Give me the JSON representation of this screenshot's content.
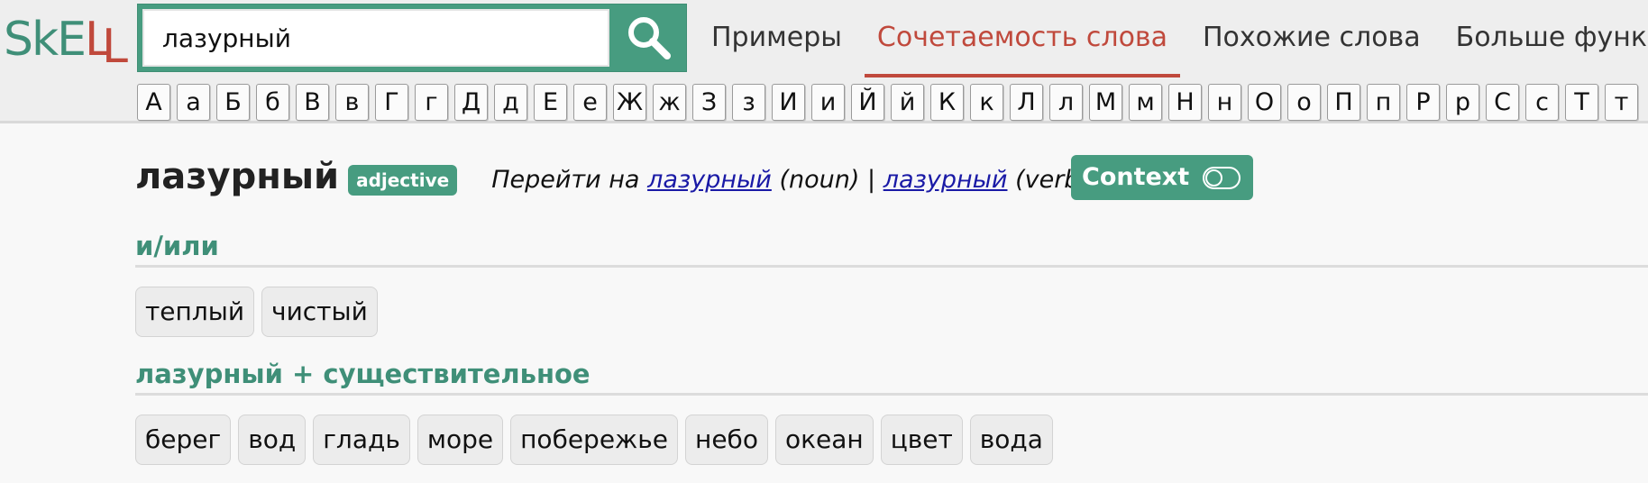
{
  "logo": {
    "s": "S",
    "k": "k",
    "e": "E",
    "l1": "L",
    "l2": "L"
  },
  "search": {
    "value": "лазурный",
    "placeholder": "",
    "button_icon": "search-icon"
  },
  "nav": {
    "items": [
      {
        "label": "Примеры",
        "active": false
      },
      {
        "label": "Сочетаемость слова",
        "active": true
      },
      {
        "label": "Похожие слова",
        "active": false
      },
      {
        "label": "Больше функций",
        "active": false
      }
    ]
  },
  "alphabet": [
    "А",
    "а",
    "Б",
    "б",
    "В",
    "в",
    "Г",
    "г",
    "Д",
    "д",
    "Е",
    "е",
    "Ж",
    "ж",
    "З",
    "з",
    "И",
    "и",
    "Й",
    "й",
    "К",
    "к",
    "Л",
    "л",
    "М",
    "м",
    "Н",
    "н",
    "О",
    "о",
    "П",
    "п",
    "Р",
    "р",
    "С",
    "с",
    "Т",
    "т"
  ],
  "entry": {
    "headword": "лазурный",
    "pos": "adjective",
    "goto_prefix": "Перейти на",
    "goto_link1": "лазурный",
    "goto_pos1": "(noun)",
    "goto_sep": "|",
    "goto_link2": "лазурный",
    "goto_pos2": "(verb)",
    "context_label": "Context"
  },
  "sections": [
    {
      "title": "и/или",
      "chips": [
        "теплый",
        "чистый"
      ]
    },
    {
      "title": "лазурный + существительное",
      "chips": [
        "берег",
        "вод",
        "гладь",
        "море",
        "побережье",
        "небо",
        "океан",
        "цвет",
        "вода"
      ]
    }
  ],
  "colors": {
    "accent": "#479c80",
    "active_nav": "#c0493c",
    "link": "#1a1aa6"
  }
}
